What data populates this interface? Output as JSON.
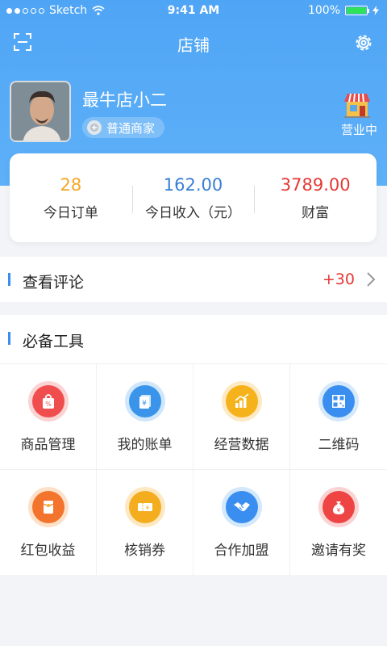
{
  "status": {
    "carrier": "Sketch",
    "time": "9:41 AM",
    "battery": "100%"
  },
  "nav": {
    "title": "店铺"
  },
  "profile": {
    "name": "最牛店小二",
    "level": "普通商家",
    "store_status": "营业中"
  },
  "stats": [
    {
      "value": "28",
      "label": "今日订单",
      "color": "#f5a623"
    },
    {
      "value": "162.00",
      "label": "今日收入（元）",
      "color": "#3a7fd5"
    },
    {
      "value": "3789.00",
      "label": "财富",
      "color": "#e53935"
    }
  ],
  "reviews": {
    "title": "查看评论",
    "count": "+30"
  },
  "tools": {
    "title": "必备工具",
    "items": [
      {
        "label": "商品管理",
        "icon": "shopping-bag-icon",
        "outer": "#fbd3d3",
        "inner": "#f04e4e"
      },
      {
        "label": "我的账单",
        "icon": "bill-icon",
        "outer": "#cfe6fb",
        "inner": "#3a95ea"
      },
      {
        "label": "经营数据",
        "icon": "bar-chart-icon",
        "outer": "#fde9c3",
        "inner": "#f6b21a"
      },
      {
        "label": "二维码",
        "icon": "qr-code-icon",
        "outer": "#d6e9fb",
        "inner": "#3a8ef0"
      },
      {
        "label": "红包收益",
        "icon": "red-envelope-icon",
        "outer": "#fde0c8",
        "inner": "#f3742c"
      },
      {
        "label": "核销券",
        "icon": "coupon-icon",
        "outer": "#fde8c2",
        "inner": "#f4ad1e"
      },
      {
        "label": "合作加盟",
        "icon": "handshake-icon",
        "outer": "#d3e8fb",
        "inner": "#3a8ef0"
      },
      {
        "label": "邀请有奖",
        "icon": "money-bag-icon",
        "outer": "#fbd3d3",
        "inner": "#ee4444"
      }
    ]
  }
}
